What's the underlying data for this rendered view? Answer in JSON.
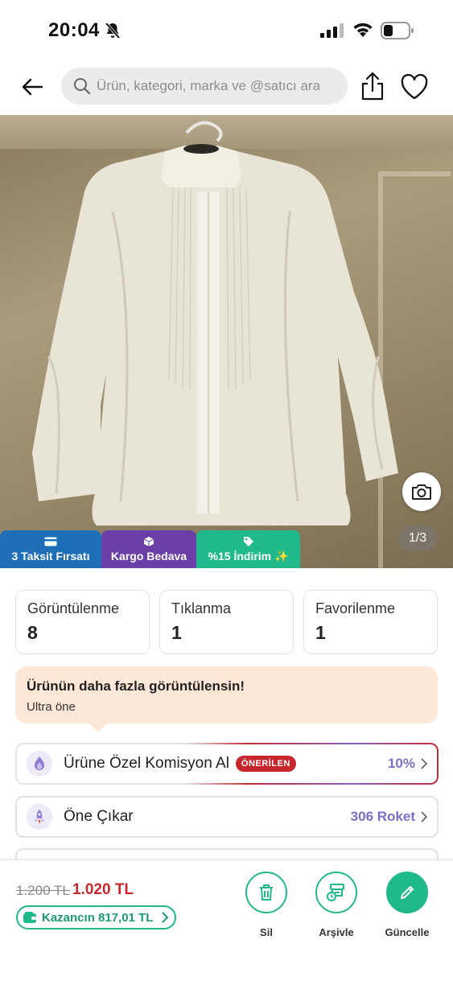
{
  "status_bar": {
    "time": "20:04"
  },
  "header": {
    "search_placeholder": "Ürün, kategori, marka ve @satıcı ara"
  },
  "photo": {
    "counter": "1/3"
  },
  "badges": [
    {
      "label": "3 Taksit Fırsatı",
      "color": "#1e6fb8"
    },
    {
      "label": "Kargo Bedava",
      "color": "#6b3fa8"
    },
    {
      "label": "%15 İndirim ✨",
      "color": "#1fb98b"
    }
  ],
  "stats": [
    {
      "label": "Görüntülenme",
      "value": "8"
    },
    {
      "label": "Tıklanma",
      "value": "1"
    },
    {
      "label": "Favorilenme",
      "value": "1"
    }
  ],
  "promo": {
    "title": "Ürünün daha fazla görüntülensin!",
    "subtitle": "Ultra öne"
  },
  "options": [
    {
      "label": "Ürüne Özel Komisyon Al",
      "tag": "ÖNERİLEN",
      "value": "10%",
      "icon": "commission-icon"
    },
    {
      "label": "Öne Çıkar",
      "value": "306 Roket",
      "icon": "rocket-icon"
    }
  ],
  "bottom": {
    "old_price": "1.200 TL",
    "new_price": "1.020 TL",
    "earnings": "Kazancın 817,01 TL",
    "actions": [
      {
        "label": "Sil",
        "icon": "trash-icon"
      },
      {
        "label": "Arşivle",
        "icon": "archive-icon"
      },
      {
        "label": "Güncelle",
        "icon": "edit-icon"
      }
    ]
  },
  "colors": {
    "accent": "#1fb98b",
    "price_red": "#c8262d",
    "purple": "#7a6fc4"
  }
}
